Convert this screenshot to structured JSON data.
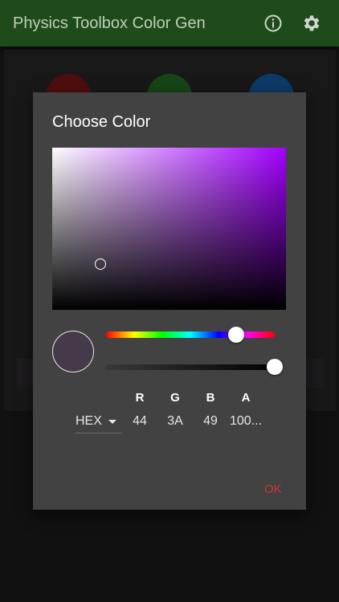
{
  "app": {
    "title": "Physics Toolbox Color Gen",
    "actions": [
      {
        "icon": "info-icon"
      },
      {
        "icon": "gear-icon"
      }
    ]
  },
  "background": {
    "circles": [
      {
        "color": "#7a1616"
      },
      {
        "color": "#236a24"
      },
      {
        "color": "#1559a0"
      }
    ]
  },
  "dialog": {
    "title": "Choose Color",
    "current_color": "#443A49",
    "picker_hue_color": "#a200ff",
    "hue_level": 0.77,
    "alpha_level": 1.0,
    "format": {
      "selected": "HEX"
    },
    "channels": [
      {
        "label": "R",
        "value": "44"
      },
      {
        "label": "G",
        "value": "3A"
      },
      {
        "label": "B",
        "value": "49"
      },
      {
        "label": "A",
        "value": "100..."
      }
    ],
    "ok_label": "OK"
  },
  "colors": {
    "appbar": "#1f4a1c",
    "ok_accent": "#d23232"
  }
}
